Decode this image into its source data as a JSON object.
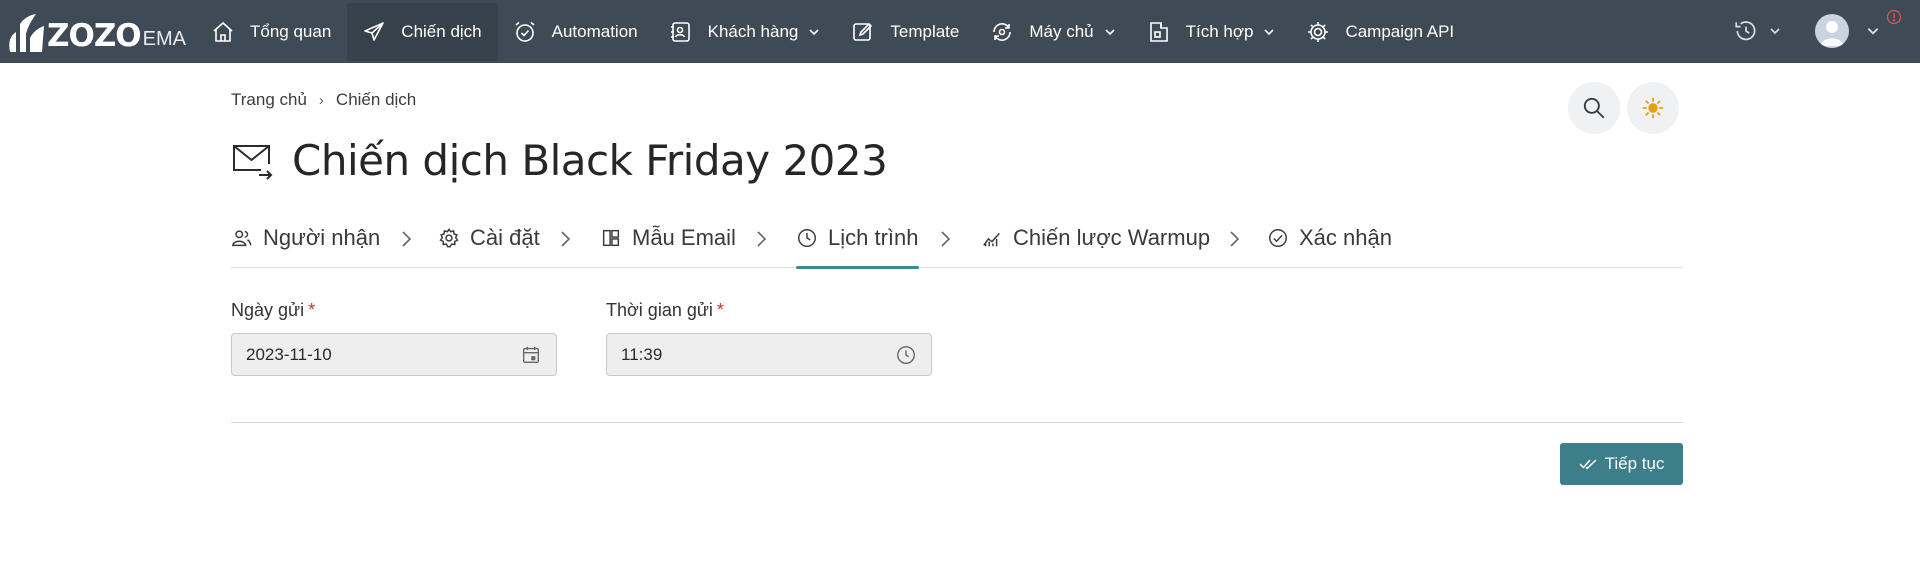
{
  "brand": {
    "logo_text": "ZOZO",
    "logo_suffix": "EMA"
  },
  "nav": {
    "items": [
      {
        "label": "Tổng quan",
        "icon": "home-icon",
        "active": false,
        "has_caret": false
      },
      {
        "label": "Chiến dịch",
        "icon": "paper-plane-icon",
        "active": true,
        "has_caret": false
      },
      {
        "label": "Automation",
        "icon": "alarm-clock-icon",
        "active": false,
        "has_caret": false
      },
      {
        "label": "Khách hàng",
        "icon": "contacts-icon",
        "active": false,
        "has_caret": true
      },
      {
        "label": "Template",
        "icon": "edit-icon",
        "active": false,
        "has_caret": false
      },
      {
        "label": "Máy chủ",
        "icon": "server-sync-icon",
        "active": false,
        "has_caret": true
      },
      {
        "label": "Tích hợp",
        "icon": "integration-icon",
        "active": false,
        "has_caret": true
      },
      {
        "label": "Campaign API",
        "icon": "api-gear-icon",
        "active": false,
        "has_caret": false
      }
    ]
  },
  "breadcrumb": {
    "home": "Trang chủ",
    "separator": "›",
    "current": "Chiến dịch"
  },
  "page": {
    "title": "Chiến dịch Black Friday 2023"
  },
  "steps": [
    {
      "label": "Người nhận",
      "icon": "users-icon",
      "active": false
    },
    {
      "label": "Cài đặt",
      "icon": "gear-icon",
      "active": false
    },
    {
      "label": "Mẫu Email",
      "icon": "layout-icon",
      "active": false
    },
    {
      "label": "Lịch trình",
      "icon": "clock-icon",
      "active": true
    },
    {
      "label": "Chiến lược Warmup",
      "icon": "chart-icon",
      "active": false
    },
    {
      "label": "Xác nhận",
      "icon": "check-circle-icon",
      "active": false
    }
  ],
  "form": {
    "send_date": {
      "label": "Ngày gửi",
      "required_mark": "*",
      "value": "2023-11-10"
    },
    "send_time": {
      "label": "Thời gian gửi",
      "required_mark": "*",
      "value": "11:39"
    }
  },
  "actions": {
    "continue_label": "Tiếp tục"
  },
  "colors": {
    "topbar": "#3e4a55",
    "accent": "#3b8a95",
    "button": "#3c7f8b",
    "required": "#c0392b",
    "sun": "#e3a21a",
    "notification": "#e05050"
  }
}
